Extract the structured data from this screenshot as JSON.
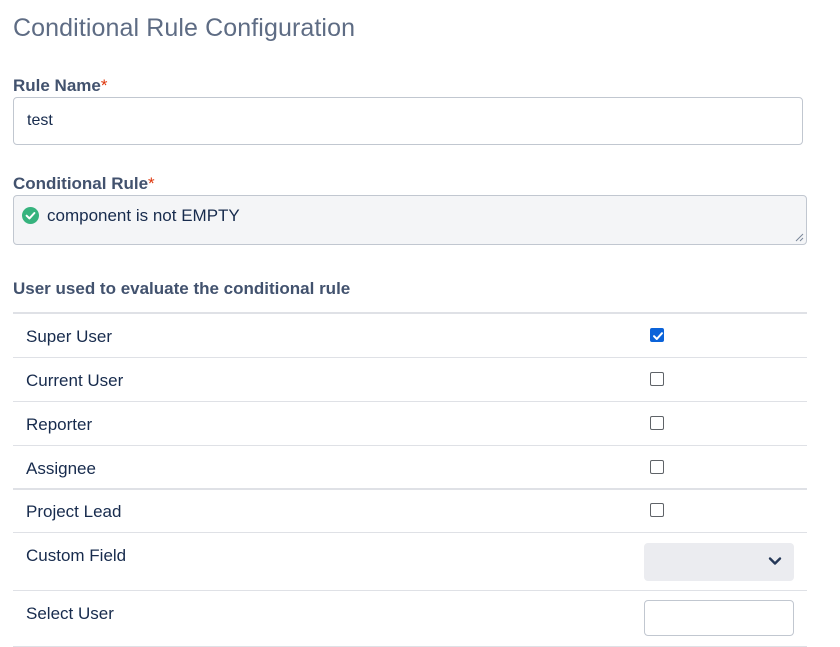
{
  "page": {
    "title": "Conditional Rule Configuration"
  },
  "rule_name": {
    "label": "Rule Name",
    "required_mark": "*",
    "value": "test"
  },
  "conditional_rule": {
    "label": "Conditional Rule",
    "required_mark": "*",
    "value": "component is not EMPTY",
    "status": "valid",
    "status_color": "#36b37e"
  },
  "users_section": {
    "heading": "User used to evaluate the conditional rule",
    "rows": [
      {
        "label": "Super User",
        "checked": true
      },
      {
        "label": "Current User",
        "checked": false
      },
      {
        "label": "Reporter",
        "checked": false
      },
      {
        "label": "Assignee",
        "checked": false
      },
      {
        "label": "Project Lead",
        "checked": false
      }
    ],
    "custom_field": {
      "label": "Custom Field",
      "selected": ""
    },
    "select_user": {
      "label": "Select User",
      "value": ""
    }
  },
  "colors": {
    "accent": "#0b63d9",
    "required": "#de350b",
    "title": "#5e6c84"
  }
}
